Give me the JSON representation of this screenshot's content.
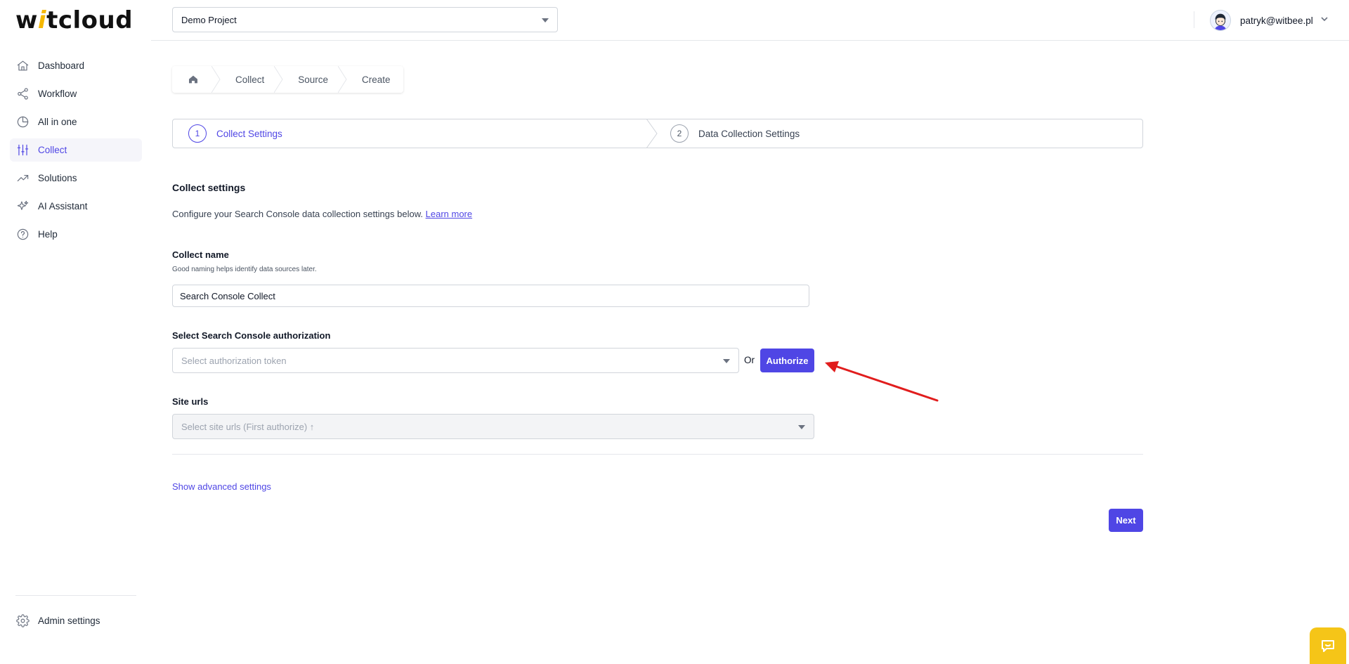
{
  "logo": {
    "part1": "w",
    "part2": "i",
    "part3": "tcloud"
  },
  "sidebar": {
    "items": [
      {
        "label": "Dashboard",
        "icon": "home-icon"
      },
      {
        "label": "Workflow",
        "icon": "share-icon"
      },
      {
        "label": "All in one",
        "icon": "pie-chart-icon"
      },
      {
        "label": "Collect",
        "icon": "sliders-icon",
        "active": true
      },
      {
        "label": "Solutions",
        "icon": "trending-up-icon"
      },
      {
        "label": "AI Assistant",
        "icon": "sparkles-icon"
      },
      {
        "label": "Help",
        "icon": "help-circle-icon"
      }
    ],
    "admin_label": "Admin settings"
  },
  "header": {
    "project": "Demo Project",
    "user_email": "patryk@witbee.pl"
  },
  "breadcrumb": {
    "items": [
      "Collect",
      "Source",
      "Create"
    ]
  },
  "stepper": {
    "steps": [
      {
        "num": "1",
        "label": "Collect Settings"
      },
      {
        "num": "2",
        "label": "Data Collection Settings"
      }
    ]
  },
  "form": {
    "title": "Collect settings",
    "description": "Configure your Search Console data collection settings below.",
    "learn_more": "Learn more",
    "collect_name_label": "Collect name",
    "collect_name_hint": "Good naming helps identify data sources later.",
    "collect_name_value": "Search Console Collect",
    "auth_label": "Select Search Console authorization",
    "auth_placeholder": "Select authorization token",
    "or_text": "Or",
    "authorize_label": "Authorize",
    "site_urls_label": "Site urls",
    "site_urls_placeholder": "Select site urls (First authorize) ↑",
    "advanced_link": "Show advanced settings",
    "next_label": "Next"
  },
  "colors": {
    "accent": "#4f46e5",
    "logo_accent": "#f5b800",
    "chat_button": "#f5c518",
    "annotation_arrow": "#e11d1d"
  }
}
